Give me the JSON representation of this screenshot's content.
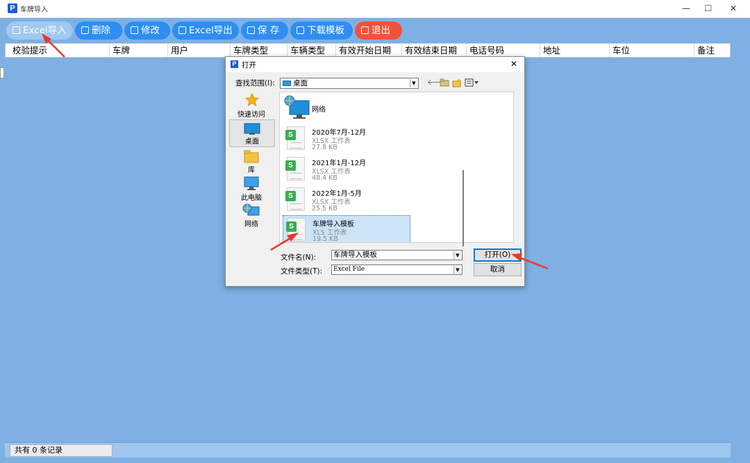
{
  "window": {
    "title": "车牌导入",
    "app_icon_letter": "P",
    "controls": {
      "minimize": "—",
      "maximize": "☐",
      "close": "✕"
    }
  },
  "toolbar": {
    "buttons": [
      {
        "label": "Excel导入",
        "icon": "excel-import-icon"
      },
      {
        "label": "删除",
        "icon": "trash-icon"
      },
      {
        "label": "修改",
        "icon": "edit-icon"
      },
      {
        "label": "Excel导出",
        "icon": "excel-export-icon"
      },
      {
        "label": "保 存",
        "icon": "save-icon"
      },
      {
        "label": "下载模板",
        "icon": "download-icon"
      },
      {
        "label": "退出",
        "icon": "exit-icon"
      }
    ]
  },
  "grid": {
    "columns": [
      "校验提示",
      "车牌",
      "用户",
      "车牌类型",
      "车辆类型",
      "有效开始日期",
      "有效结束日期",
      "电话号码",
      "地址",
      "车位",
      "备注"
    ]
  },
  "status": {
    "text": "共有 0 条记录"
  },
  "dialog": {
    "title": "打开",
    "close": "✕",
    "lookin_label": "查找范围(I):",
    "lookin_value": "桌面",
    "places": [
      {
        "label": "快速访问",
        "icon": "star-icon"
      },
      {
        "label": "桌面",
        "icon": "desktop-icon"
      },
      {
        "label": "库",
        "icon": "library-folder-icon"
      },
      {
        "label": "此电脑",
        "icon": "computer-icon"
      },
      {
        "label": "网络",
        "icon": "network-icon"
      }
    ],
    "files": [
      {
        "name": "网络",
        "type": "",
        "size": ""
      },
      {
        "name": "2020年7月-12月",
        "type": "XLSX 工作表",
        "size": "27.8 KB"
      },
      {
        "name": "2021年1月-12月",
        "type": "XLSX 工作表",
        "size": "48.4 KB"
      },
      {
        "name": "2022年1月-5月",
        "type": "XLSX 工作表",
        "size": "25.5 KB"
      },
      {
        "name": "车牌导入模板",
        "type": "XLS 工作表",
        "size": "19.5 KB"
      }
    ],
    "filename_label": "文件名(N):",
    "filename_value": "车牌导入模板",
    "filetype_label": "文件类型(T):",
    "filetype_value": "Excel File",
    "open_label": "打开(O)",
    "cancel_label": "取消"
  },
  "colors": {
    "accent_button": "#2e8ef1",
    "exit_button": "#f0523c",
    "background": "#7eb0e4",
    "selection": "#cce4f7",
    "annotation_arrow": "#e8392a"
  }
}
